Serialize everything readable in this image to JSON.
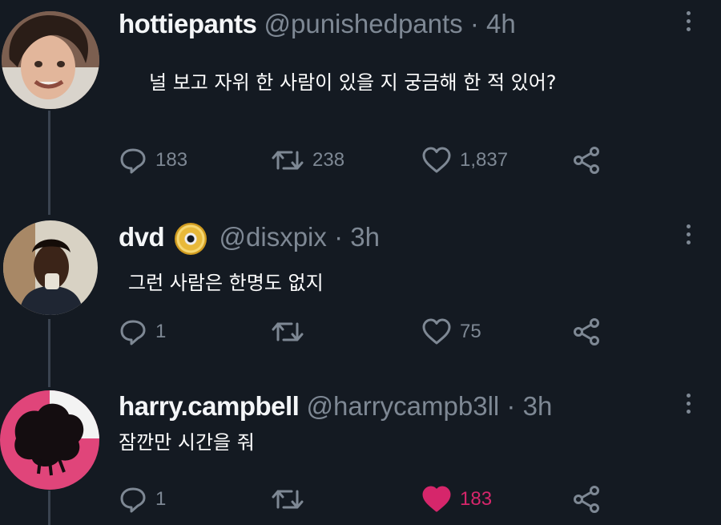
{
  "tweets": [
    {
      "name": "hottiepants",
      "handle": "@punishedpants",
      "separator": "·",
      "time": "4h",
      "text": "널 보고 자위 한 사람이 있을 지 궁금해 한 적 있어?",
      "replies": "183",
      "retweets": "238",
      "likes": "1,837",
      "liked": false
    },
    {
      "name": "dvd",
      "badge_icon": "dvd-disc-emoji",
      "handle": "@disxpix",
      "separator": "·",
      "time": "3h",
      "text": "그런 사람은 한명도 없지",
      "replies": "1",
      "retweets": "",
      "likes": "75",
      "liked": false
    },
    {
      "name": "harry.campbell",
      "handle": "@harrycampb3ll",
      "separator": "·",
      "time": "3h",
      "text": "잠깐만 시간을 줘",
      "replies": "1",
      "retweets": "",
      "likes": "183",
      "liked": true
    }
  ],
  "colors": {
    "background": "#141a22",
    "muted": "#7e8894",
    "like_active": "#d6266b",
    "thread_line": "#3a4350"
  },
  "icons": [
    "reply-icon",
    "retweet-icon",
    "like-icon",
    "share-icon",
    "more-options-icon"
  ]
}
